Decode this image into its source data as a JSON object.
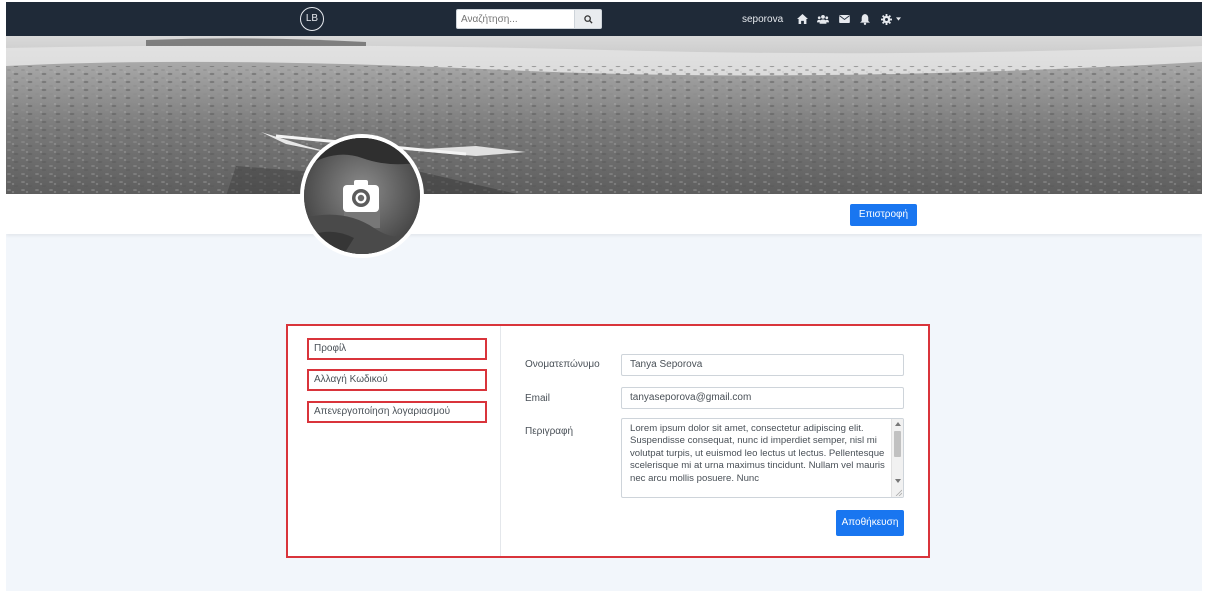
{
  "navbar": {
    "logo_text": "LB",
    "search": {
      "placeholder": "Αναζήτηση...",
      "icon": "search-icon"
    },
    "username": "seporova",
    "icons": [
      "home-icon",
      "users-icon",
      "envelope-icon",
      "bell-icon",
      "gear-icon"
    ]
  },
  "profile_header": {
    "avatar_icon": "camera-icon",
    "back_button": "Επιστροφή"
  },
  "settings_menu": {
    "items": [
      {
        "label": "Προφίλ"
      },
      {
        "label": "Αλλαγή Κωδικού"
      },
      {
        "label": "Απενεργοποίηση λογαριασμού"
      }
    ]
  },
  "profile_form": {
    "fullname_label": "Ονοματεπώνυμο",
    "fullname_value": "Tanya Seporova",
    "email_label": "Email",
    "email_value": "tanyaseporova@gmail.com",
    "description_label": "Περιγραφή",
    "description_value": "Lorem ipsum dolor sit amet, consectetur adipiscing elit. Suspendisse consequat, nunc id imperdiet semper, nisl mi volutpat turpis, ut euismod leo lectus ut lectus. Pellentesque scelerisque mi at urna maximus tincidunt. Nullam vel mauris nec arcu mollis posuere. Nunc",
    "save_button": "Αποθήκευση"
  },
  "colors": {
    "navbar_bg": "#1f2a38",
    "accent": "#1976f0",
    "highlight_border": "#d9343b",
    "page_bg": "#f2f6fb"
  }
}
